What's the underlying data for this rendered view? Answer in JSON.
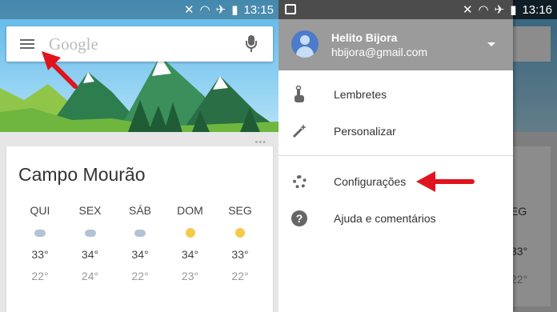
{
  "left_screen": {
    "status": {
      "time": "13:15"
    },
    "search": {
      "placeholder": "Google"
    },
    "weather": {
      "city": "Campo Mourão",
      "days": [
        {
          "name": "QUI",
          "high": "33°",
          "low": "22°",
          "icon": "rain-cloud-icon"
        },
        {
          "name": "SEX",
          "high": "34°",
          "low": "24°",
          "icon": "rain-cloud-icon"
        },
        {
          "name": "SÁB",
          "high": "34°",
          "low": "22°",
          "icon": "rain-cloud-icon"
        },
        {
          "name": "DOM",
          "high": "34°",
          "low": "23°",
          "icon": "sun-icon"
        },
        {
          "name": "SEG",
          "high": "33°",
          "low": "22°",
          "icon": "sun-icon"
        }
      ]
    }
  },
  "right_screen": {
    "status": {
      "time": "13:16"
    },
    "account": {
      "name": "Helito Bijora",
      "email": "hbijora@gmail.com"
    },
    "menu": [
      {
        "label": "Lembretes",
        "icon": "reminder-hand-icon"
      },
      {
        "label": "Personalizar",
        "icon": "magic-wand-icon"
      },
      {
        "label": "Configurações",
        "icon": "gear-icon"
      },
      {
        "label": "Ajuda e comentários",
        "icon": "help-icon"
      }
    ],
    "peek": {
      "day": "EG",
      "hi": "33°",
      "lo": "22°"
    }
  },
  "colors": {
    "arrow": "#e0141e",
    "drawer_header": "#9b9b9b",
    "sun": "#f6c94a"
  }
}
